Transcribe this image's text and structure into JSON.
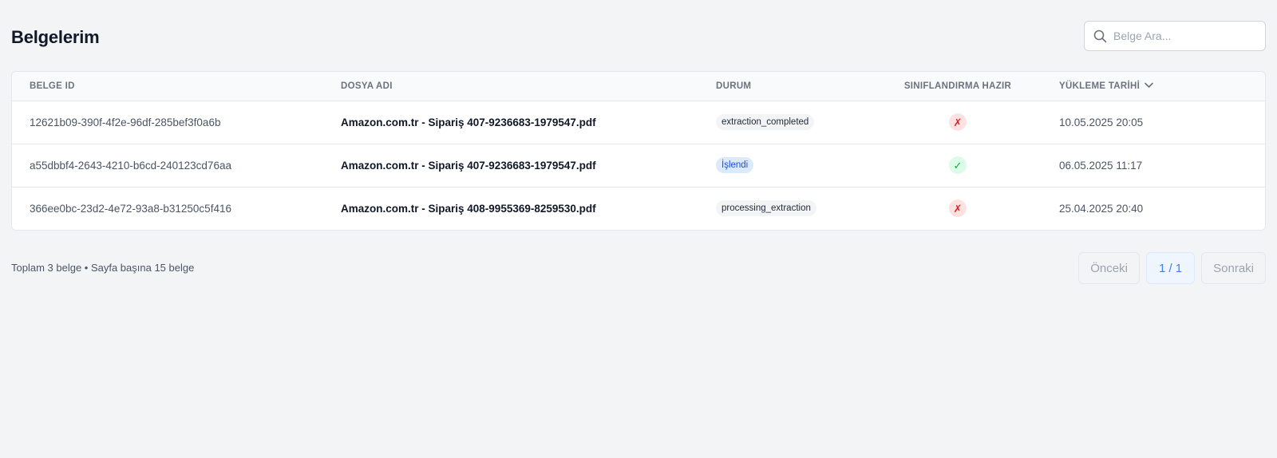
{
  "header": {
    "title": "Belgelerim",
    "search_placeholder": "Belge Ara...",
    "search_icon": "search-icon"
  },
  "table": {
    "columns": {
      "id": "BELGE ID",
      "name": "DOSYA ADI",
      "status": "DURUM",
      "ready": "SINIFLANDIRMA HAZIR",
      "date": "YÜKLEME TARİHİ"
    },
    "sort_icon": "chevron-down-icon",
    "rows": [
      {
        "id": "12621b09-390f-4f2e-96df-285bef3f0a6b",
        "name": "Amazon.com.tr - Sipariş 407-9236683-1979547.pdf",
        "status": "extraction_completed",
        "ready": "✗",
        "date": "10.05.2025 20:05"
      },
      {
        "id": "a55dbbf4-2643-4210-b6cd-240123cd76aa",
        "name": "Amazon.com.tr - Sipariş 407-9236683-1979547.pdf",
        "status": "İşlendi",
        "ready": "✓",
        "date": "06.05.2025 11:17"
      },
      {
        "id": "366ee0bc-23d2-4e72-93a8-b31250c5f416",
        "name": "Amazon.com.tr - Sipariş 408-9955369-8259530.pdf",
        "status": "processing_extraction",
        "ready": "✗",
        "date": "25.04.2025 20:40"
      }
    ]
  },
  "footer": {
    "summary": "Toplam 3 belge • Sayfa başına 15 belge",
    "prev_label": "Önceki",
    "page_label": "1 / 1",
    "next_label": "Sonraki"
  },
  "colors": {
    "accent": "#3b82f6",
    "success": "#16a34a",
    "danger": "#dc2626"
  }
}
